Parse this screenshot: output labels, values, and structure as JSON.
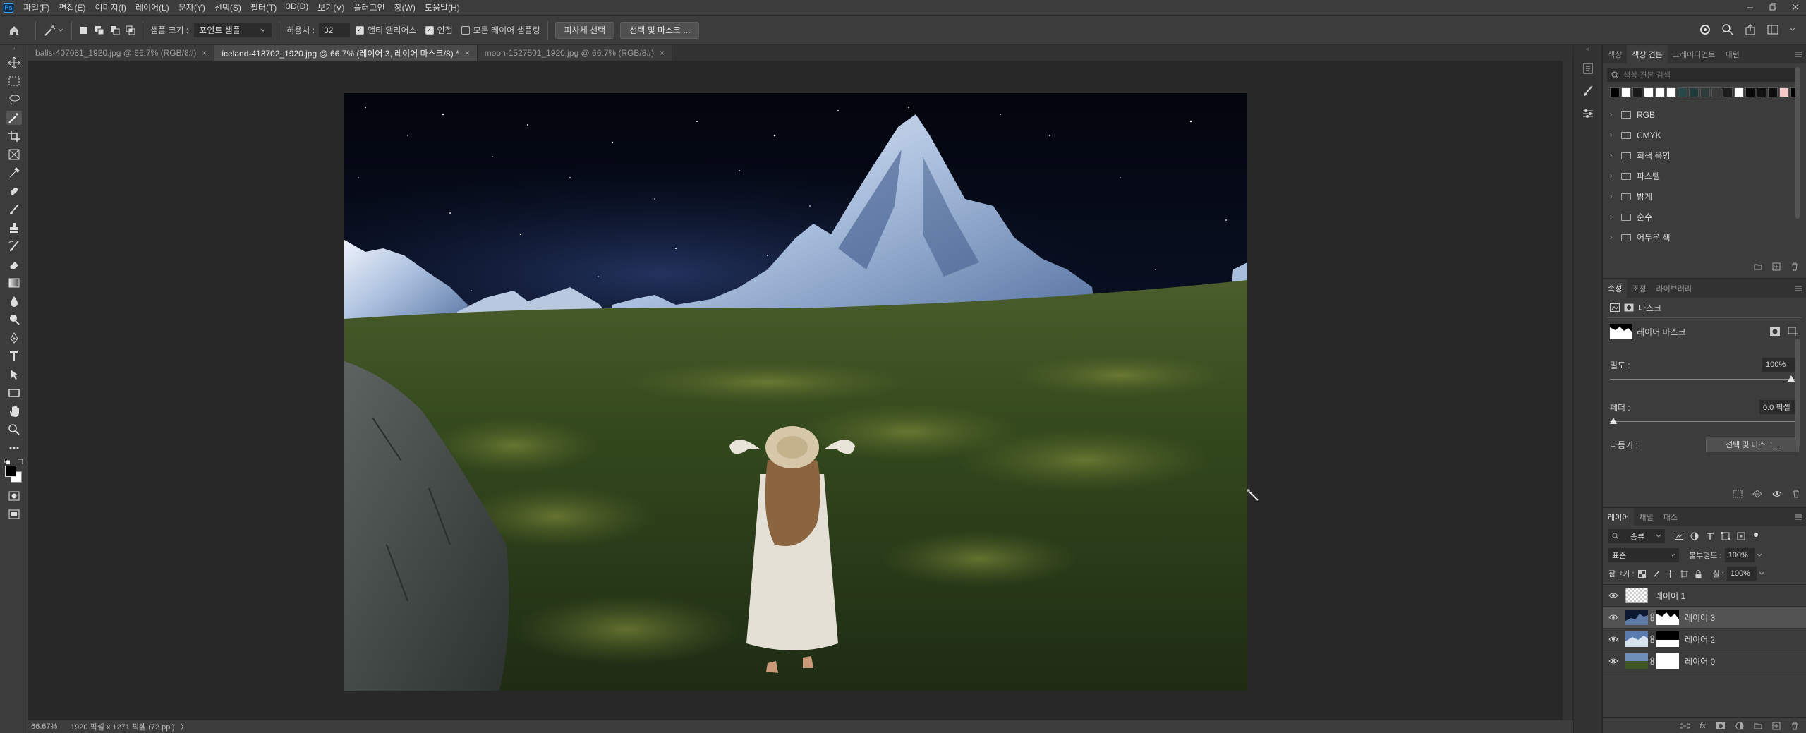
{
  "app": {
    "logo": "Ps"
  },
  "menu": [
    "파일(F)",
    "편집(E)",
    "이미지(I)",
    "레이어(L)",
    "문자(Y)",
    "선택(S)",
    "필터(T)",
    "3D(D)",
    "보기(V)",
    "플러그인",
    "창(W)",
    "도움말(H)"
  ],
  "options": {
    "sample_size_label": "샘플 크기 :",
    "sample_size_value": "포인트 샘플",
    "tolerance_label": "허용치 :",
    "tolerance_value": "32",
    "anti_alias_label": "앤티 앨리어스",
    "contiguous_label": "인접",
    "sample_all_layers_label": "모든 레이어 샘플링",
    "select_subject_label": "피사체 선택",
    "select_and_mask_label": "선택 및 마스크 ..."
  },
  "tabs": [
    {
      "label": "balls-407081_1920.jpg @ 66.7% (RGB/8#)",
      "active": false
    },
    {
      "label": "iceland-413702_1920.jpg @ 66.7% (레이어 3, 레이어 마스크/8) *",
      "active": true
    },
    {
      "label": "moon-1527501_1920.jpg @ 66.7% (RGB/8#)",
      "active": false
    }
  ],
  "status": {
    "zoom": "66.67%",
    "doc_info": "1920 픽셀 x 1271 픽셀 (72 ppi)",
    "arrow": "〉"
  },
  "swatches_panel": {
    "tabs": [
      "색상",
      "색상 견본",
      "그레이디언트",
      "패턴"
    ],
    "active_tab": 1,
    "search_placeholder": "색상 견본 검색",
    "colors": [
      "#000000",
      "#ffffff",
      "#1a1a1a",
      "#ffffff",
      "#ffffff",
      "#ffffff",
      "#2a4a4a",
      "#1f3b3b",
      "#2e3b3b",
      "#3a3a3a",
      "#1c1c1c",
      "#ffffff",
      "#0a0a0a",
      "#111111",
      "#0d0d0d",
      "#f7c9c9",
      "#000000"
    ],
    "folders": [
      "RGB",
      "CMYK",
      "회색 음영",
      "파스텔",
      "밝게",
      "순수",
      "어두운 색"
    ]
  },
  "properties_panel": {
    "tabs": [
      "속성",
      "조정",
      "라이브러리"
    ],
    "active_tab": 0,
    "type_label": "마스크",
    "mask_label": "레이어 마스크",
    "density_label": "밀도 :",
    "density_value": "100%",
    "density_level": 1.0,
    "feather_label": "페더 :",
    "feather_value": "0.0 픽셀",
    "feather_level": 0.0,
    "refine_label": "다듬기 :",
    "refine_button": "선택 및 마스크..."
  },
  "layers_panel": {
    "tabs": [
      "레이어",
      "채널",
      "패스"
    ],
    "active_tab": 0,
    "filter_kind": "종류",
    "blend_mode": "표준",
    "opacity_label": "불투명도 :",
    "opacity_value": "100%",
    "lock_label": "잠그기 :",
    "fill_label": "칠 :",
    "fill_value": "100%",
    "layers": [
      {
        "name": "레이어 1",
        "selected": false,
        "mask": false
      },
      {
        "name": "레이어 3",
        "selected": true,
        "mask": true
      },
      {
        "name": "레이어 2",
        "selected": false,
        "mask": true
      },
      {
        "name": "레이어 0",
        "selected": false,
        "mask": true
      }
    ]
  },
  "colors": {
    "accent": "#31a8ff",
    "panel": "#3c3c3c",
    "canvas_bg": "#282828"
  }
}
